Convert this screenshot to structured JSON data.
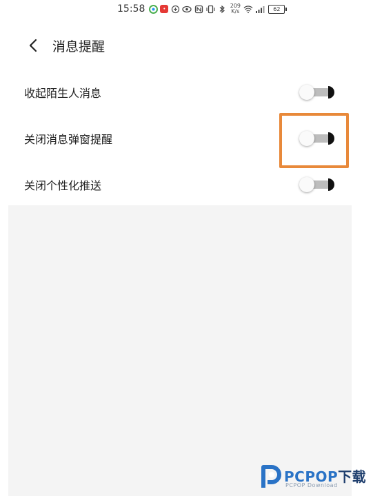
{
  "status_bar": {
    "time": "15:58",
    "net_speed_value": "209",
    "net_speed_unit": "K/s",
    "battery": "62"
  },
  "header": {
    "title": "消息提醒"
  },
  "settings": [
    {
      "label": "收起陌生人消息",
      "enabled": false
    },
    {
      "label": "关闭消息弹窗提醒",
      "enabled": false
    },
    {
      "label": "关闭个性化推送",
      "enabled": false
    }
  ],
  "watermark": {
    "brand": "PCPOP",
    "brand_cn": "下载",
    "sub": "PCPOP Download",
    "color": "#2a73c6"
  },
  "colors": {
    "highlight": "#e8893a",
    "toggle_track": "#bdbdbd",
    "panel_bg": "#f4f4f4"
  }
}
